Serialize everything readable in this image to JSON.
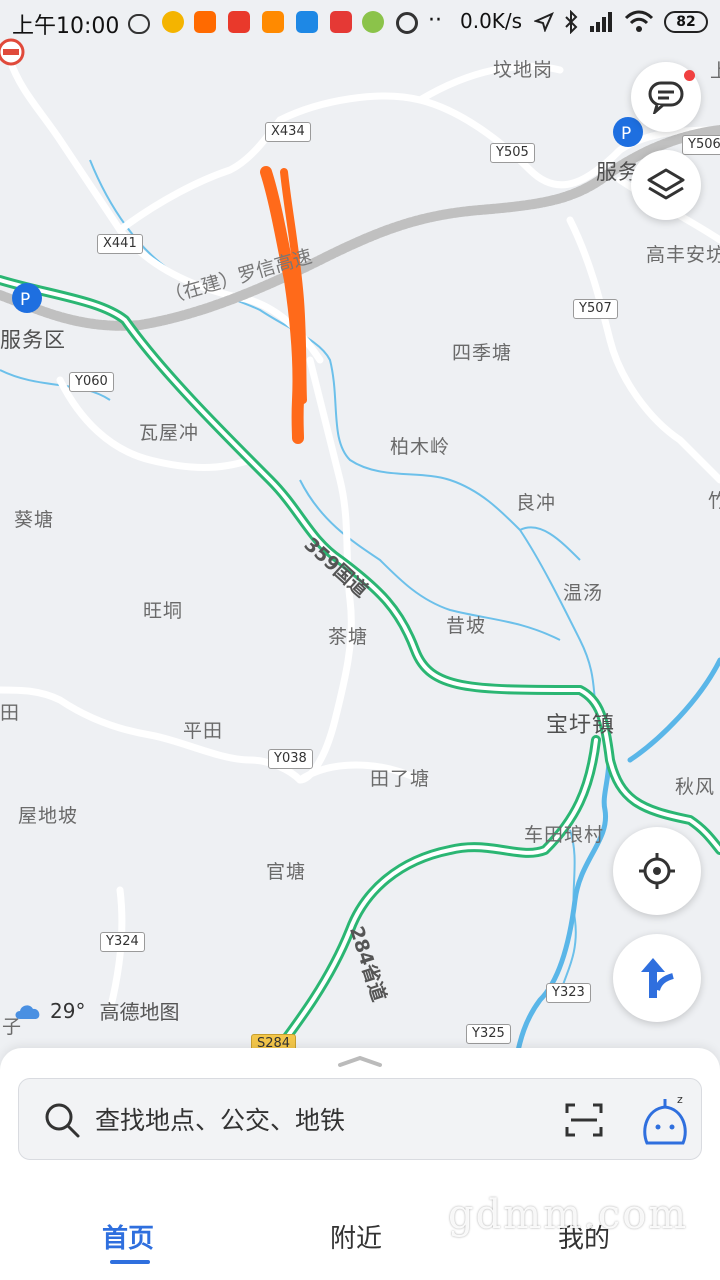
{
  "status_bar": {
    "time": "上午10:00",
    "net_speed": "0.0K/s",
    "battery": "82",
    "app_icon_colors": [
      "#e04a3b",
      "#f4b400",
      "#ff6a00",
      "#e9392b",
      "#ff8a00",
      "#1e88e5",
      "#e53935",
      "#8bc34a",
      "#333333"
    ]
  },
  "map": {
    "place_labels": [
      {
        "text": "坟地岗"
      },
      {
        "text": "服务"
      },
      {
        "text": "高丰安坊"
      },
      {
        "text": "服务区"
      },
      {
        "text": "四季塘"
      },
      {
        "text": "瓦屋冲"
      },
      {
        "text": "柏木岭"
      },
      {
        "text": "良冲"
      },
      {
        "text": "葵塘"
      },
      {
        "text": "旺垌"
      },
      {
        "text": "温汤"
      },
      {
        "text": "茶塘"
      },
      {
        "text": "昔坡"
      },
      {
        "text": "宝圩镇"
      },
      {
        "text": "田"
      },
      {
        "text": "平田"
      },
      {
        "text": "田了塘"
      },
      {
        "text": "秋风"
      },
      {
        "text": "屋地坡"
      },
      {
        "text": "车田琅村"
      },
      {
        "text": "官塘"
      },
      {
        "text": "竹"
      },
      {
        "text": "子"
      },
      {
        "text": "上"
      }
    ],
    "road_shields": [
      "X434",
      "Y505",
      "Y506",
      "X441",
      "Y507",
      "Y060",
      "Y038",
      "Y324",
      "Y323",
      "Y325",
      "S284"
    ],
    "road_names": {
      "expressway": "（在建）罗信高速",
      "national": "359国道",
      "provincial": "284省道"
    },
    "colors": {
      "background": "#eef0f3",
      "road": "#ffffff",
      "green_road": "#2bb673",
      "construction": "#b9b9b9",
      "river": "#5ab6e8",
      "annotation": "#ff6a1a",
      "accent": "#2f6fde"
    }
  },
  "weather": {
    "temperature": "29°",
    "brand": "高德地图",
    "icon": "cloud-icon"
  },
  "buttons": {
    "messages": "chat-bubble-icon",
    "layers": "layers-icon",
    "locate": "crosshair-icon",
    "route": "route-arrow-icon"
  },
  "search": {
    "placeholder": "查找地点、公交、地铁",
    "scan_icon": "scan-icon",
    "voice_icon": "voice-assistant-icon"
  },
  "tabs": [
    {
      "label": "首页",
      "active": true
    },
    {
      "label": "附近"
    },
    {
      "label": "我的"
    }
  ],
  "watermark": "gdmm.com"
}
